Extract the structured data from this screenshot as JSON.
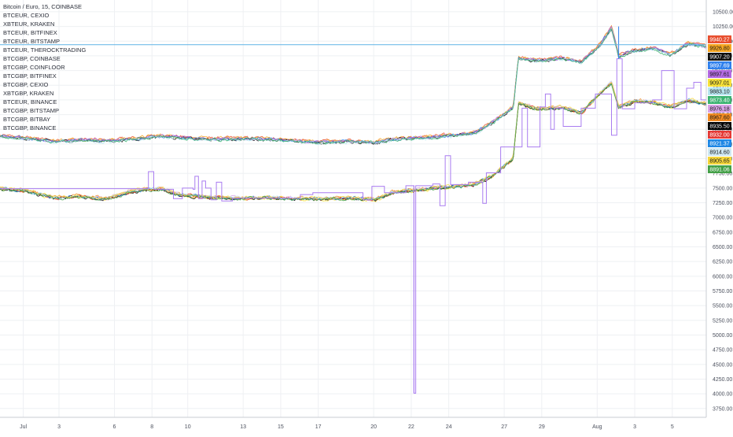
{
  "chart_data": {
    "type": "line",
    "title": "Bitcoin / Euro, 15, COINBASE",
    "legend_placement": "top-left",
    "grid": true,
    "y_axis": {
      "position": "right",
      "ylim": [
        3600,
        10700
      ],
      "ticks": [
        3750,
        4000,
        4250,
        4500,
        4750,
        5000,
        5250,
        5500,
        5750,
        6000,
        6250,
        6500,
        6750,
        7000,
        7250,
        7500,
        7750,
        8000,
        8250,
        8500,
        8750,
        9000,
        9250,
        9500,
        9750,
        10000,
        10250,
        10500
      ],
      "tick_labels": [
        "3750.00",
        "4000.00",
        "4250.00",
        "4500.00",
        "4750.00",
        "5000.00",
        "5250.00",
        "5500.00",
        "5750.00",
        "6000.00",
        "6250.00",
        "6500.00",
        "6750.00",
        "7000.00",
        "7250.00",
        "7500.00",
        "7750.00",
        "8000.00",
        "8250.00",
        "8500.00",
        "8750.00",
        "9000.00",
        "9250.00",
        "9500.00",
        "9750.00",
        "10000.00",
        "10250.00",
        "10500.00"
      ]
    },
    "x_axis": {
      "xlim": [
        0,
        39.5
      ],
      "ticks": [
        {
          "t": 1.3,
          "label": "Jul"
        },
        {
          "t": 3.3,
          "label": "3"
        },
        {
          "t": 6.4,
          "label": "6"
        },
        {
          "t": 8.5,
          "label": "8"
        },
        {
          "t": 10.5,
          "label": "10"
        },
        {
          "t": 13.6,
          "label": "13"
        },
        {
          "t": 15.7,
          "label": "15"
        },
        {
          "t": 17.8,
          "label": "17"
        },
        {
          "t": 20.9,
          "label": "20"
        },
        {
          "t": 23.0,
          "label": "22"
        },
        {
          "t": 25.1,
          "label": "24"
        },
        {
          "t": 28.2,
          "label": "27"
        },
        {
          "t": 30.3,
          "label": "29"
        },
        {
          "t": 33.4,
          "label": "Aug"
        },
        {
          "t": 35.5,
          "label": "3"
        },
        {
          "t": 37.6,
          "label": "5"
        }
      ]
    },
    "horizontal_line": {
      "value": 9940.27,
      "color": "#5fb3e6"
    },
    "series": [
      {
        "name": "BTCEUR, CEXIO",
        "color": "#e84f2f",
        "last_value": "9940.27",
        "group": "eur_high"
      },
      {
        "name": "XBTEUR, KRAKEN",
        "color": "#f6a623",
        "last_value": "9926.80",
        "group": "eur_high"
      },
      {
        "name": "BTCEUR, BITFINEX",
        "color": "#111111",
        "last_value": "9907.20",
        "group": "eur"
      },
      {
        "name": "BTCEUR, BITSTAMP",
        "color": "#2f80ed",
        "last_value": "9897.69",
        "group": "eur"
      },
      {
        "name": "BTCEUR, THEROCKTRADING",
        "color": "#b36ae2",
        "last_value": "9897.61",
        "group": "eur"
      },
      {
        "name": "BTCGBP, COINBASE",
        "color": "#f7e23b",
        "last_value": "9097.01",
        "group": "gbp"
      },
      {
        "name": "BTCGBP, COINFLOOR",
        "color": "#b8e6f0",
        "last_value": "9883.10",
        "group": "eur"
      },
      {
        "name": "BTCGBP, BITFINEX",
        "color": "#3cb371",
        "last_value": "9873.40",
        "group": "eur"
      },
      {
        "name": "BTCGBP, CEXIO",
        "color": "#d9a3e6",
        "last_value": "8976.18",
        "group": "gbp"
      },
      {
        "name": "XBTGBP, KRAKEN",
        "color": "#f08a24",
        "last_value": "8967.60",
        "group": "gbp"
      },
      {
        "name": "BTCEUR, BINANCE",
        "color": "#000000",
        "last_value": "8935.50",
        "group": "gbp"
      },
      {
        "name": "BTCGBP, BITSTAMP",
        "color": "#e53935",
        "last_value": "8932.00",
        "group": "gbp"
      },
      {
        "name": "BTCGBP, BITBAY",
        "color": "#1e88e5",
        "last_value": "8921.37",
        "group": "gbp"
      },
      {
        "name": "BTCGBP, BINANCE",
        "color": "#cfe8f3",
        "last_value": "8914.60",
        "group": "gbp"
      },
      {
        "name": "",
        "color": "#f5d63b",
        "last_value": "8905.65",
        "group": "gbp"
      },
      {
        "name": "",
        "color": "#43a047",
        "last_value": "8891.06",
        "group": "gbp"
      }
    ],
    "anchors": {
      "eur": [
        [
          0,
          8370
        ],
        [
          1.5,
          8340
        ],
        [
          3,
          8290
        ],
        [
          4.5,
          8310
        ],
        [
          6,
          8295
        ],
        [
          7.5,
          8330
        ],
        [
          9,
          8380
        ],
        [
          10,
          8355
        ],
        [
          11.5,
          8320
        ],
        [
          13,
          8330
        ],
        [
          15,
          8330
        ],
        [
          16.5,
          8290
        ],
        [
          18,
          8270
        ],
        [
          19.5,
          8285
        ],
        [
          21,
          8270
        ],
        [
          22,
          8330
        ],
        [
          23.5,
          8340
        ],
        [
          25,
          8380
        ],
        [
          26.5,
          8420
        ],
        [
          27.5,
          8600
        ],
        [
          28.7,
          8860
        ],
        [
          29,
          9700
        ],
        [
          30,
          9660
        ],
        [
          31.5,
          9700
        ],
        [
          32.5,
          9640
        ],
        [
          33.5,
          9900
        ],
        [
          34.2,
          10220
        ],
        [
          34.6,
          9740
        ],
        [
          35.5,
          9830
        ],
        [
          36.5,
          9870
        ],
        [
          37.5,
          9760
        ],
        [
          38.5,
          9950
        ],
        [
          39.5,
          9895
        ]
      ],
      "gbp": [
        [
          0,
          7490
        ],
        [
          1.5,
          7450
        ],
        [
          3,
          7340
        ],
        [
          4.5,
          7360
        ],
        [
          6,
          7320
        ],
        [
          7.5,
          7460
        ],
        [
          9,
          7490
        ],
        [
          10,
          7390
        ],
        [
          11.5,
          7350
        ],
        [
          13,
          7330
        ],
        [
          15,
          7340
        ],
        [
          16.5,
          7320
        ],
        [
          18,
          7320
        ],
        [
          19.5,
          7330
        ],
        [
          21,
          7310
        ],
        [
          22,
          7430
        ],
        [
          23.5,
          7470
        ],
        [
          25,
          7520
        ],
        [
          26.5,
          7560
        ],
        [
          27.5,
          7700
        ],
        [
          28.7,
          8000
        ],
        [
          29,
          8950
        ],
        [
          30,
          8850
        ],
        [
          31.5,
          8870
        ],
        [
          32.5,
          8780
        ],
        [
          33.5,
          9100
        ],
        [
          34.2,
          9300
        ],
        [
          34.6,
          8880
        ],
        [
          35.5,
          8980
        ],
        [
          36.5,
          8960
        ],
        [
          37.5,
          8880
        ],
        [
          38.5,
          9000
        ],
        [
          39.5,
          8930
        ]
      ]
    },
    "purple_overlay": {
      "color": "#a97cf0",
      "steps": [
        [
          0,
          7490
        ],
        [
          8.1,
          7490
        ],
        [
          8.3,
          7780
        ],
        [
          8.6,
          7480
        ],
        [
          9.5,
          7480
        ],
        [
          9.7,
          7320
        ],
        [
          10.2,
          7500
        ],
        [
          10.8,
          7480
        ],
        [
          10.9,
          7700
        ],
        [
          11.1,
          7320
        ],
        [
          11.3,
          7620
        ],
        [
          11.5,
          7500
        ],
        [
          11.8,
          7300
        ],
        [
          12.1,
          7600
        ],
        [
          12.4,
          7280
        ],
        [
          13,
          7330
        ],
        [
          16.8,
          7390
        ],
        [
          17.5,
          7420
        ],
        [
          18.5,
          7420
        ],
        [
          20.2,
          7420
        ],
        [
          20.3,
          7300
        ],
        [
          20.8,
          7530
        ],
        [
          21.5,
          7420
        ],
        [
          22.6,
          7420
        ],
        [
          22.7,
          7540
        ],
        [
          23.1,
          7540
        ],
        [
          23.15,
          4010
        ],
        [
          23.25,
          7540
        ],
        [
          24.2,
          7570
        ],
        [
          24.6,
          7200
        ],
        [
          24.9,
          8050
        ],
        [
          25.2,
          7560
        ],
        [
          26.2,
          7600
        ],
        [
          26.9,
          7600
        ],
        [
          27.0,
          7240
        ],
        [
          27.2,
          7760
        ],
        [
          27.5,
          7760
        ],
        [
          28.0,
          8200
        ],
        [
          28.8,
          8200
        ],
        [
          29.2,
          8860
        ],
        [
          29.5,
          8200
        ],
        [
          30.2,
          8880
        ],
        [
          30.5,
          9100
        ],
        [
          30.8,
          8500
        ],
        [
          31.0,
          8860
        ],
        [
          31.5,
          8550
        ],
        [
          32.5,
          8860
        ],
        [
          33.3,
          9100
        ],
        [
          33.8,
          9100
        ],
        [
          34.2,
          8400
        ],
        [
          34.5,
          9700
        ],
        [
          34.8,
          8850
        ],
        [
          35.5,
          8950
        ],
        [
          36.5,
          9000
        ],
        [
          37.0,
          9500
        ],
        [
          37.6,
          9500
        ],
        [
          37.7,
          8850
        ],
        [
          38.4,
          9200
        ],
        [
          38.8,
          9300
        ],
        [
          39.2,
          9000
        ],
        [
          39.5,
          8900
        ]
      ]
    },
    "spikes": [
      {
        "t": 23.15,
        "value": 4010,
        "color": "#a97cf0"
      },
      {
        "t": 34.6,
        "value": 10250,
        "color": "#2f80ed"
      }
    ]
  }
}
